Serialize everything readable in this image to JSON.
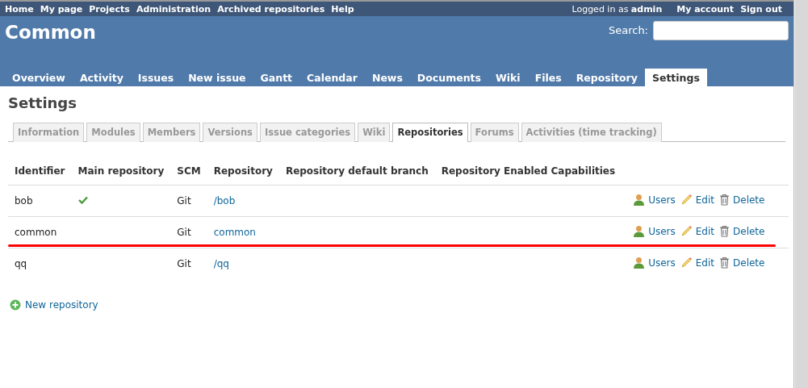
{
  "top_menu": {
    "links": [
      "Home",
      "My page",
      "Projects",
      "Administration",
      "Archived repositories",
      "Help"
    ],
    "logged_in_prefix": "Logged in as",
    "user": "admin",
    "account_links": [
      "My account",
      "Sign out"
    ]
  },
  "header": {
    "title": "Common",
    "search_label": "Search:"
  },
  "main_menu": [
    {
      "label": "Overview",
      "selected": false
    },
    {
      "label": "Activity",
      "selected": false
    },
    {
      "label": "Issues",
      "selected": false
    },
    {
      "label": "New issue",
      "selected": false
    },
    {
      "label": "Gantt",
      "selected": false
    },
    {
      "label": "Calendar",
      "selected": false
    },
    {
      "label": "News",
      "selected": false
    },
    {
      "label": "Documents",
      "selected": false
    },
    {
      "label": "Wiki",
      "selected": false
    },
    {
      "label": "Files",
      "selected": false
    },
    {
      "label": "Repository",
      "selected": false
    },
    {
      "label": "Settings",
      "selected": true
    }
  ],
  "page_title": "Settings",
  "settings_tabs": [
    {
      "label": "Information",
      "selected": false
    },
    {
      "label": "Modules",
      "selected": false
    },
    {
      "label": "Members",
      "selected": false
    },
    {
      "label": "Versions",
      "selected": false
    },
    {
      "label": "Issue categories",
      "selected": false
    },
    {
      "label": "Wiki",
      "selected": false
    },
    {
      "label": "Repositories",
      "selected": true
    },
    {
      "label": "Forums",
      "selected": false
    },
    {
      "label": "Activities (time tracking)",
      "selected": false
    }
  ],
  "table": {
    "columns": [
      "Identifier",
      "Main repository",
      "SCM",
      "Repository",
      "Repository default branch",
      "Repository Enabled Capabilities"
    ],
    "rows": [
      {
        "identifier": "bob",
        "main": true,
        "scm": "Git",
        "repository": "/bob",
        "actions": [
          "Users",
          "Edit",
          "Delete"
        ],
        "underlined": false
      },
      {
        "identifier": "common",
        "main": false,
        "scm": "Git",
        "repository": "common",
        "actions": [
          "Users",
          "Edit",
          "Delete"
        ],
        "underlined": true
      },
      {
        "identifier": "qq",
        "main": false,
        "scm": "Git",
        "repository": "/qq",
        "actions": [
          "Users",
          "Edit",
          "Delete"
        ],
        "underlined": false
      }
    ]
  },
  "new_repository": "New repository"
}
